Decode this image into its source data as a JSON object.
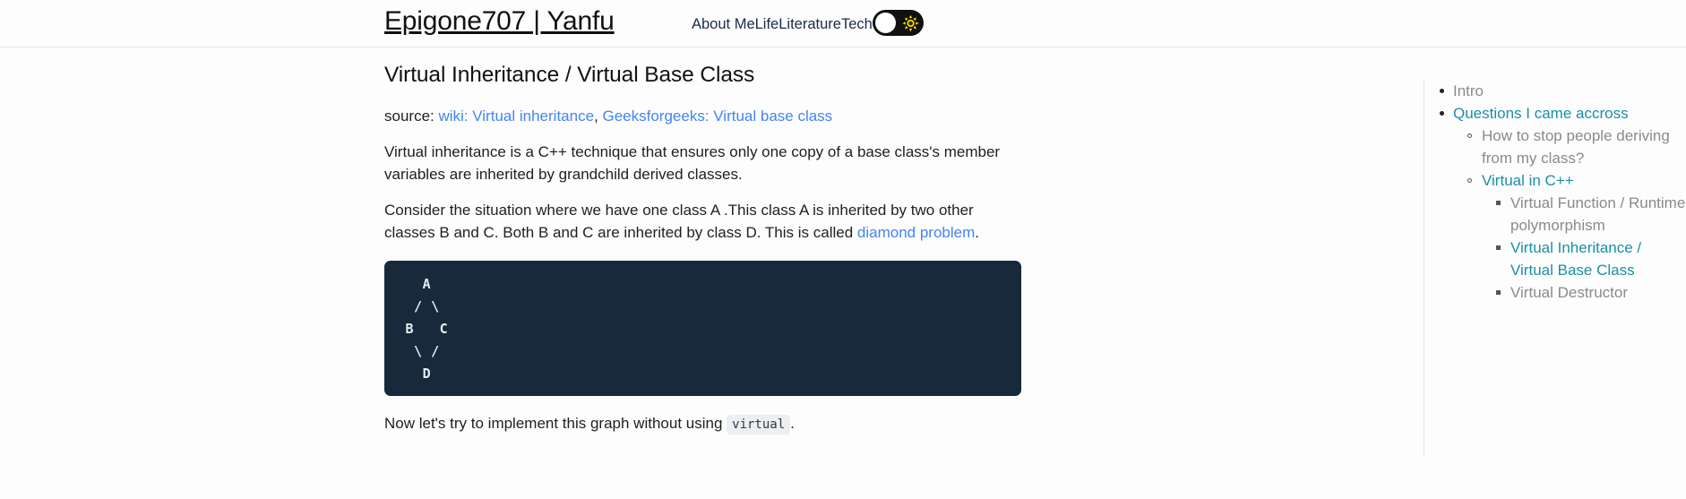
{
  "header": {
    "site_title": "Epigone707 | Yanfu",
    "nav": [
      {
        "label": "About Me",
        "name": "nav-link-about-me"
      },
      {
        "label": "Life",
        "name": "nav-link-life"
      },
      {
        "label": "Literature",
        "name": "nav-link-literature"
      },
      {
        "label": "Tech",
        "name": "nav-link-tech"
      }
    ],
    "theme_toggle": {
      "state": "light",
      "icon": "sun-icon",
      "track_color": "#111111",
      "knob_color": "#ffffff",
      "sun_color": "#ffe600"
    }
  },
  "article": {
    "title": "Virtual Inheritance / Virtual Base Class",
    "source_label": "source:",
    "source_links": [
      {
        "label": "wiki: Virtual inheritance"
      },
      {
        "label": "Geeksforgeeks: Virtual base class"
      }
    ],
    "source_separator": ", ",
    "paragraph_1": "Virtual inheritance is a C++ technique that ensures only one copy of a base class's member variables are inherited by grandchild derived classes.",
    "paragraph_2_part1": "Consider the situation where we have one class A .This class A is inherited by two other classes B and C. Both B and C are inherited by class D. This is called ",
    "paragraph_2_link": "diamond problem",
    "paragraph_2_part2": ".",
    "code_block": "   A\n  / \\\n B   C\n  \\ /\n   D",
    "paragraph_3_part1": "Now let's try to implement this graph without using ",
    "paragraph_3_code": "virtual",
    "paragraph_3_part2": "."
  },
  "toc": {
    "items": [
      {
        "label": "Intro",
        "active": false,
        "level": 1
      },
      {
        "label": "Questions I came accross",
        "active": true,
        "level": 1
      },
      {
        "label": "How to stop people deriving from my class?",
        "active": false,
        "level": 2
      },
      {
        "label": "Virtual in C++",
        "active": true,
        "level": 2
      },
      {
        "label": "Virtual Function / Runtime polymorphism",
        "active": false,
        "level": 3
      },
      {
        "label": "Virtual Inheritance / Virtual Base Class",
        "active": true,
        "level": 3
      },
      {
        "label": "Virtual Destructor",
        "active": false,
        "level": 3
      }
    ]
  },
  "colors": {
    "page_bg": "#fdfdfd",
    "link": "#4285f4",
    "toc_active": "#1a8fa8",
    "toc_inactive": "#8a8a8a",
    "code_bg": "#17293a",
    "code_text": "#e6edf3",
    "inline_code_bg": "#eceff1"
  }
}
